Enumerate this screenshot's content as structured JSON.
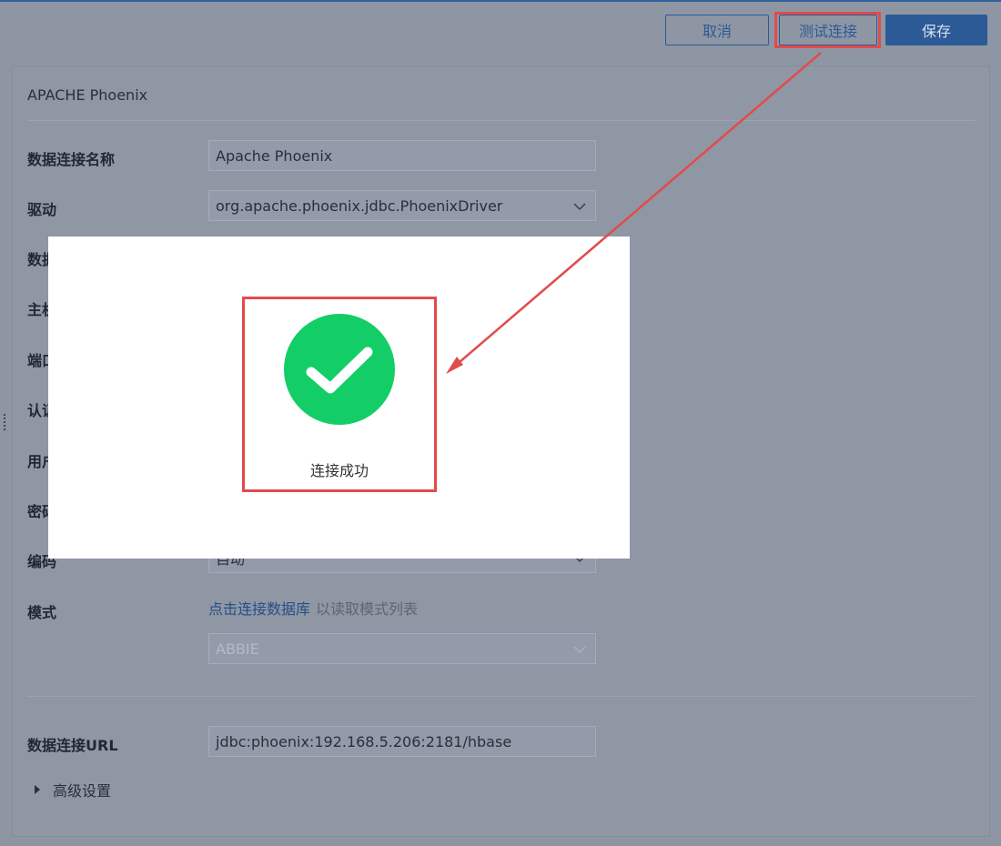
{
  "toolbar": {
    "cancel_label": "取消",
    "test_label": "测试连接",
    "save_label": "保存"
  },
  "panel": {
    "title": "APACHE Phoenix",
    "fields": {
      "name_label": "数据连接名称",
      "name_value": "Apache Phoenix",
      "driver_label": "驱动",
      "driver_value": "org.apache.phoenix.jdbc.PhoenixDriver",
      "db_label_partial": "数据",
      "host_label_partial": "主机",
      "port_label_partial": "端口",
      "auth_label_partial": "认证",
      "user_label_partial": "用户",
      "password_label_partial": "密码",
      "encoding_label": "编码",
      "encoding_value_partial": "自动",
      "mode_label": "模式",
      "mode_link": "点击连接数据库",
      "mode_link_rest": "以读取模式列表",
      "mode_value": "ABBIE",
      "url_label": "数据连接URL",
      "url_value": "jdbc:phoenix:192.168.5.206:2181/hbase",
      "advanced_label": "高级设置"
    }
  },
  "modal": {
    "message": "连接成功",
    "icon": "check-circle-icon"
  },
  "colors": {
    "primary": "#2b5a96",
    "success": "#13ce66",
    "annotation": "#e24b4b"
  }
}
